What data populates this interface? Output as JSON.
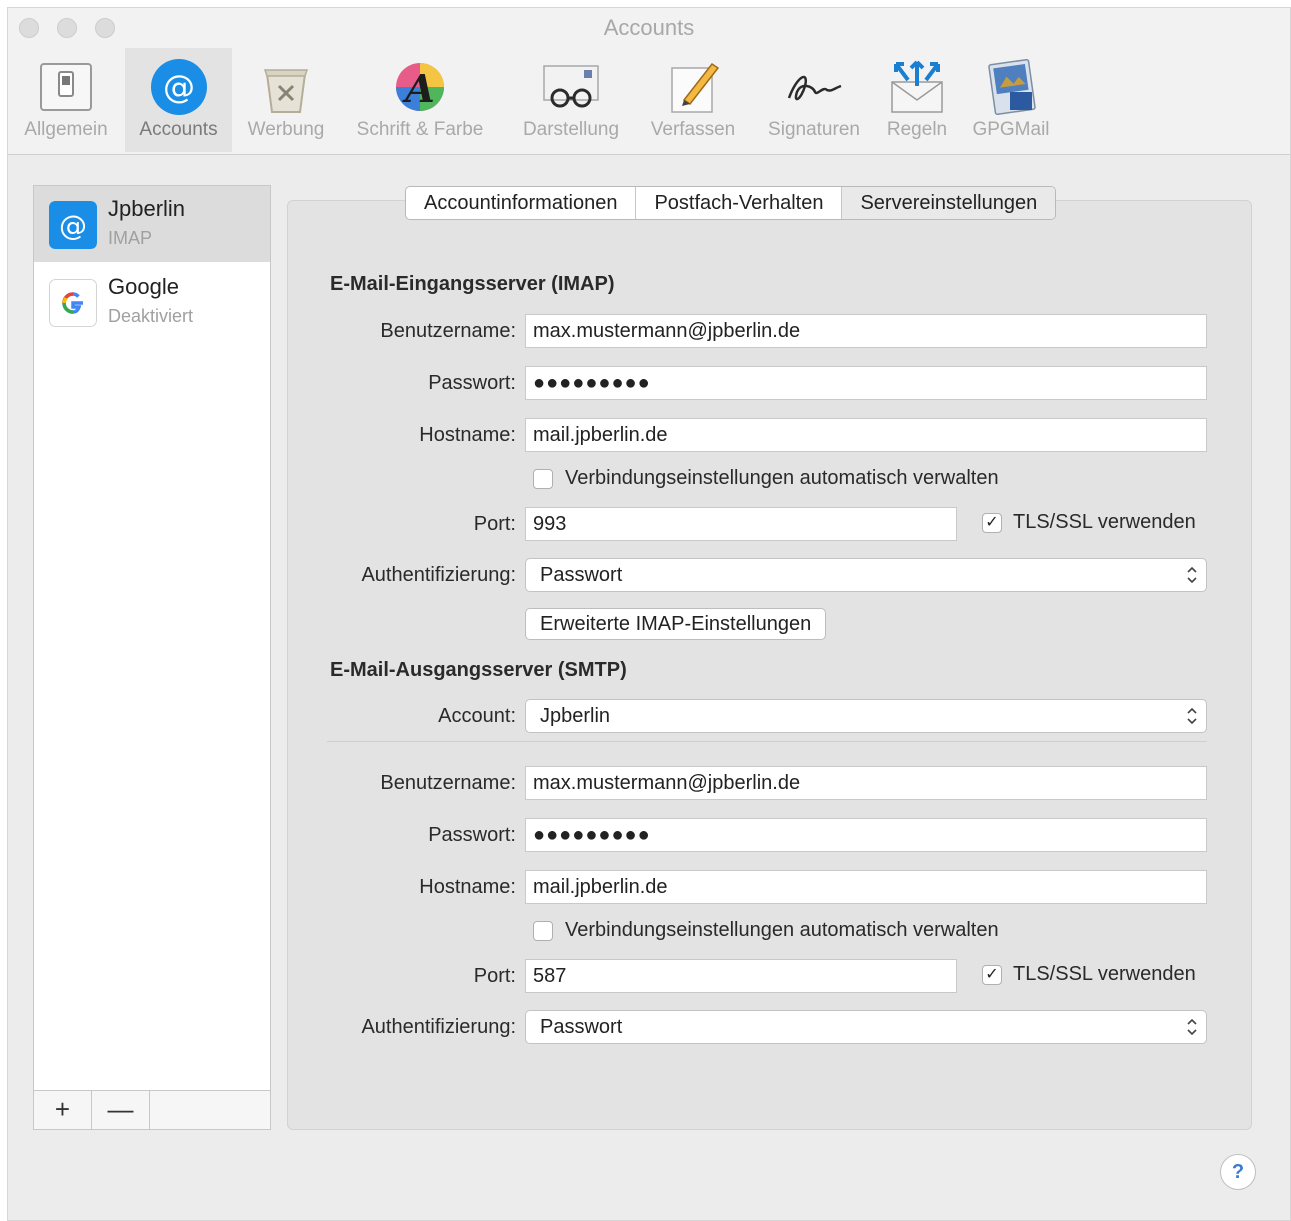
{
  "window": {
    "title": "Accounts"
  },
  "toolbar": {
    "items": [
      {
        "label": "Allgemein",
        "icon": "switch-icon"
      },
      {
        "label": "Accounts",
        "icon": "at-icon"
      },
      {
        "label": "Werbung",
        "icon": "trash-icon"
      },
      {
        "label": "Schrift & Farbe",
        "icon": "font-color-icon"
      },
      {
        "label": "Darstellung",
        "icon": "glasses-icon"
      },
      {
        "label": "Verfassen",
        "icon": "pencil-icon"
      },
      {
        "label": "Signaturen",
        "icon": "signature-icon"
      },
      {
        "label": "Regeln",
        "icon": "rules-icon"
      },
      {
        "label": "GPGMail",
        "icon": "gpg-icon"
      }
    ]
  },
  "sidebar": {
    "accounts": [
      {
        "name": "Jpberlin",
        "sub": "IMAP",
        "selected": true
      },
      {
        "name": "Google",
        "sub": "Deaktiviert",
        "selected": false
      }
    ],
    "add": "+",
    "remove": "—"
  },
  "tabs": [
    "Accountinformationen",
    "Postfach-Verhalten",
    "Servereinstellungen"
  ],
  "imap": {
    "title": "E-Mail-Eingangsserver (IMAP)",
    "username_label": "Benutzername:",
    "username": "max.mustermann@jpberlin.de",
    "password_label": "Passwort:",
    "password": "●●●●●●●●●",
    "host_label": "Hostname:",
    "host": "mail.jpberlin.de",
    "auto_label": "Verbindungseinstellungen automatisch verwalten",
    "port_label": "Port:",
    "port": "993",
    "tls_label": "TLS/SSL verwenden",
    "tls_check": "✓",
    "auth_label": "Authentifizierung:",
    "auth": "Passwort",
    "advanced_button": "Erweiterte IMAP-Einstellungen"
  },
  "smtp": {
    "title": "E-Mail-Ausgangsserver (SMTP)",
    "account_label": "Account:",
    "account": "Jpberlin",
    "username_label": "Benutzername:",
    "username": "max.mustermann@jpberlin.de",
    "password_label": "Passwort:",
    "password": "●●●●●●●●●",
    "host_label": "Hostname:",
    "host": "mail.jpberlin.de",
    "auto_label": "Verbindungseinstellungen automatisch verwalten",
    "port_label": "Port:",
    "port": "587",
    "tls_label": "TLS/SSL verwenden",
    "tls_check": "✓",
    "auth_label": "Authentifizierung:",
    "auth": "Passwort"
  },
  "select_arrow": "⌃⌄",
  "help": "?",
  "colors": {
    "accent": "#1a8ee6",
    "panel": "#e3e3e3"
  }
}
